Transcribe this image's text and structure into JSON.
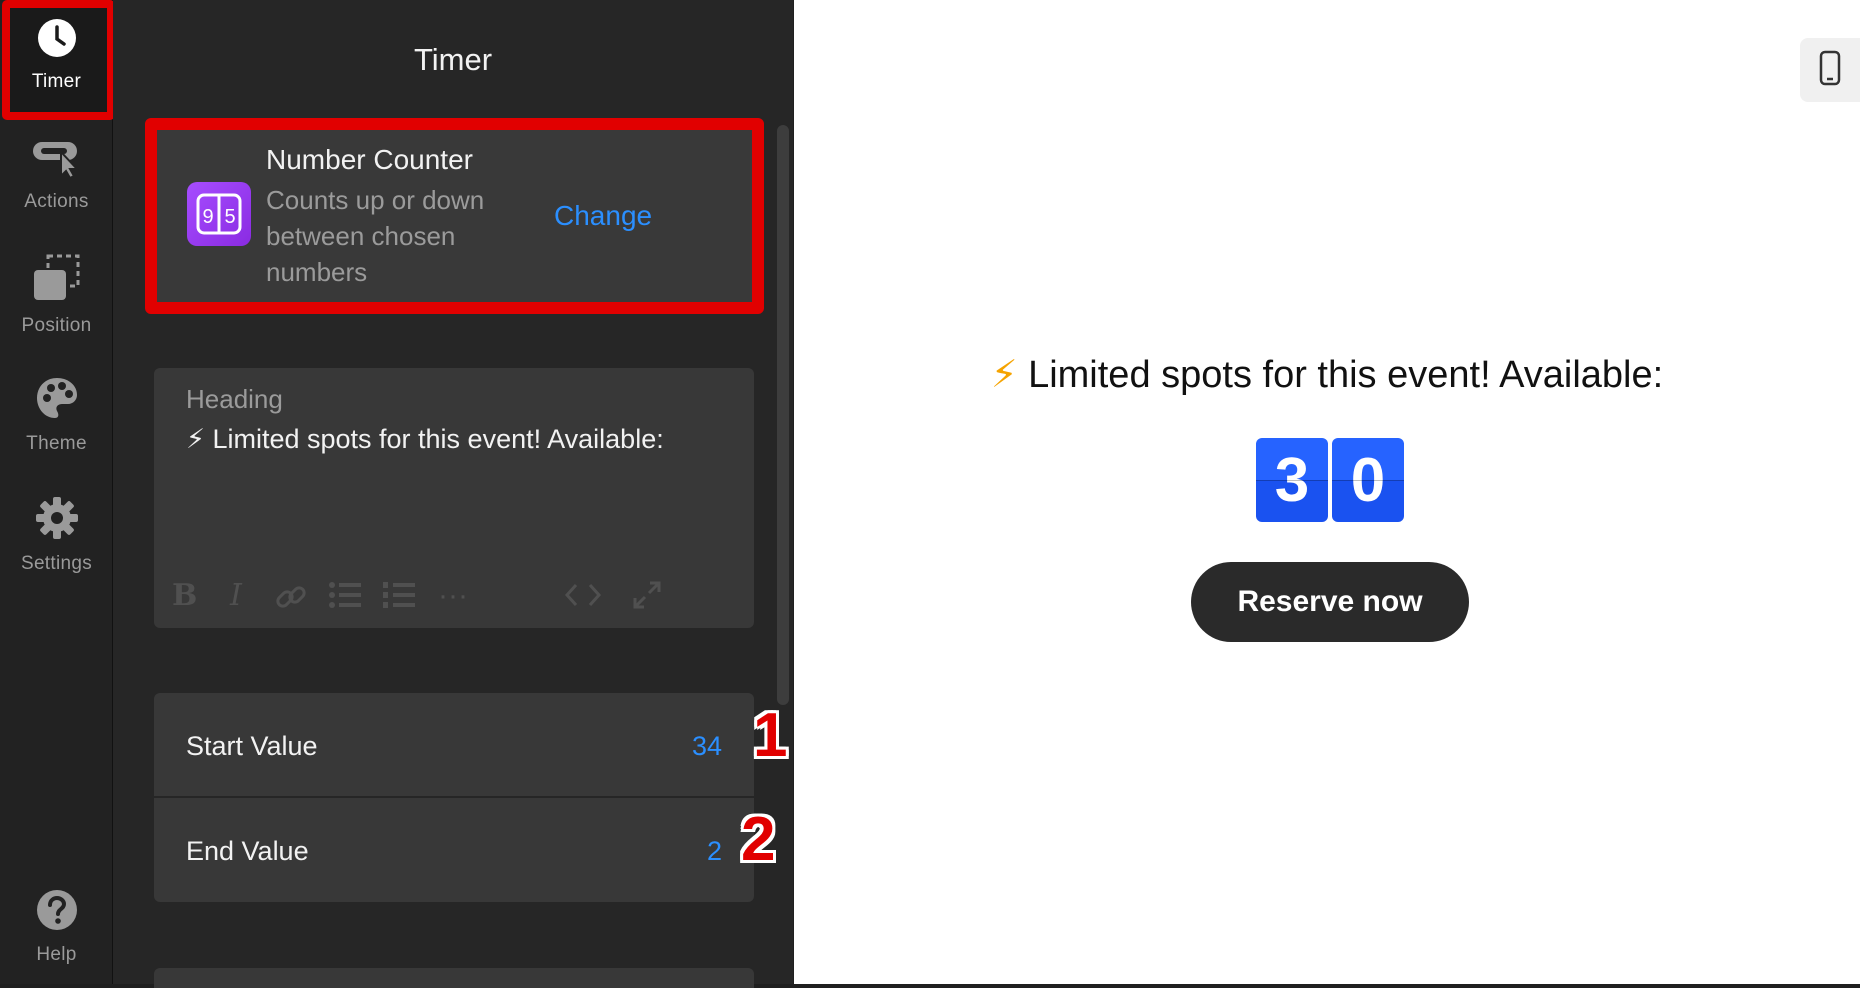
{
  "rail": {
    "items": [
      {
        "label": "Timer",
        "icon": "clock-icon"
      },
      {
        "label": "Actions",
        "icon": "cursor-click-icon"
      },
      {
        "label": "Position",
        "icon": "position-icon"
      },
      {
        "label": "Theme",
        "icon": "palette-icon"
      },
      {
        "label": "Settings",
        "icon": "gear-icon"
      },
      {
        "label": "Help",
        "icon": "help-icon"
      }
    ],
    "active": "Timer"
  },
  "panel": {
    "title": "Timer",
    "counter": {
      "name": "Number Counter",
      "description": "Counts up or down between chosen numbers",
      "change_label": "Change",
      "icon": "number-counter-icon"
    },
    "heading": {
      "label": "Heading",
      "text": "⚡ Limited spots for this event! Available:",
      "toolbar": [
        "bold-icon",
        "italic-icon",
        "link-icon",
        "bullet-list-icon",
        "numbered-list-icon",
        "more-icon",
        "code-icon",
        "expand-icon"
      ]
    },
    "fields": [
      {
        "label": "Start Value",
        "value": "34"
      },
      {
        "label": "End Value",
        "value": "2"
      }
    ],
    "annotations": [
      "1",
      "2"
    ]
  },
  "preview": {
    "bolt": "⚡",
    "heading": "Limited spots for this event! Available:",
    "digits": [
      "3",
      "0"
    ],
    "button_label": "Reserve now",
    "device_icon": "mobile-icon"
  },
  "colors": {
    "accent": "#2b8fff",
    "highlight": "#e10000",
    "digit_bg": "#2663ff",
    "button_bg": "#2a2a2a"
  }
}
